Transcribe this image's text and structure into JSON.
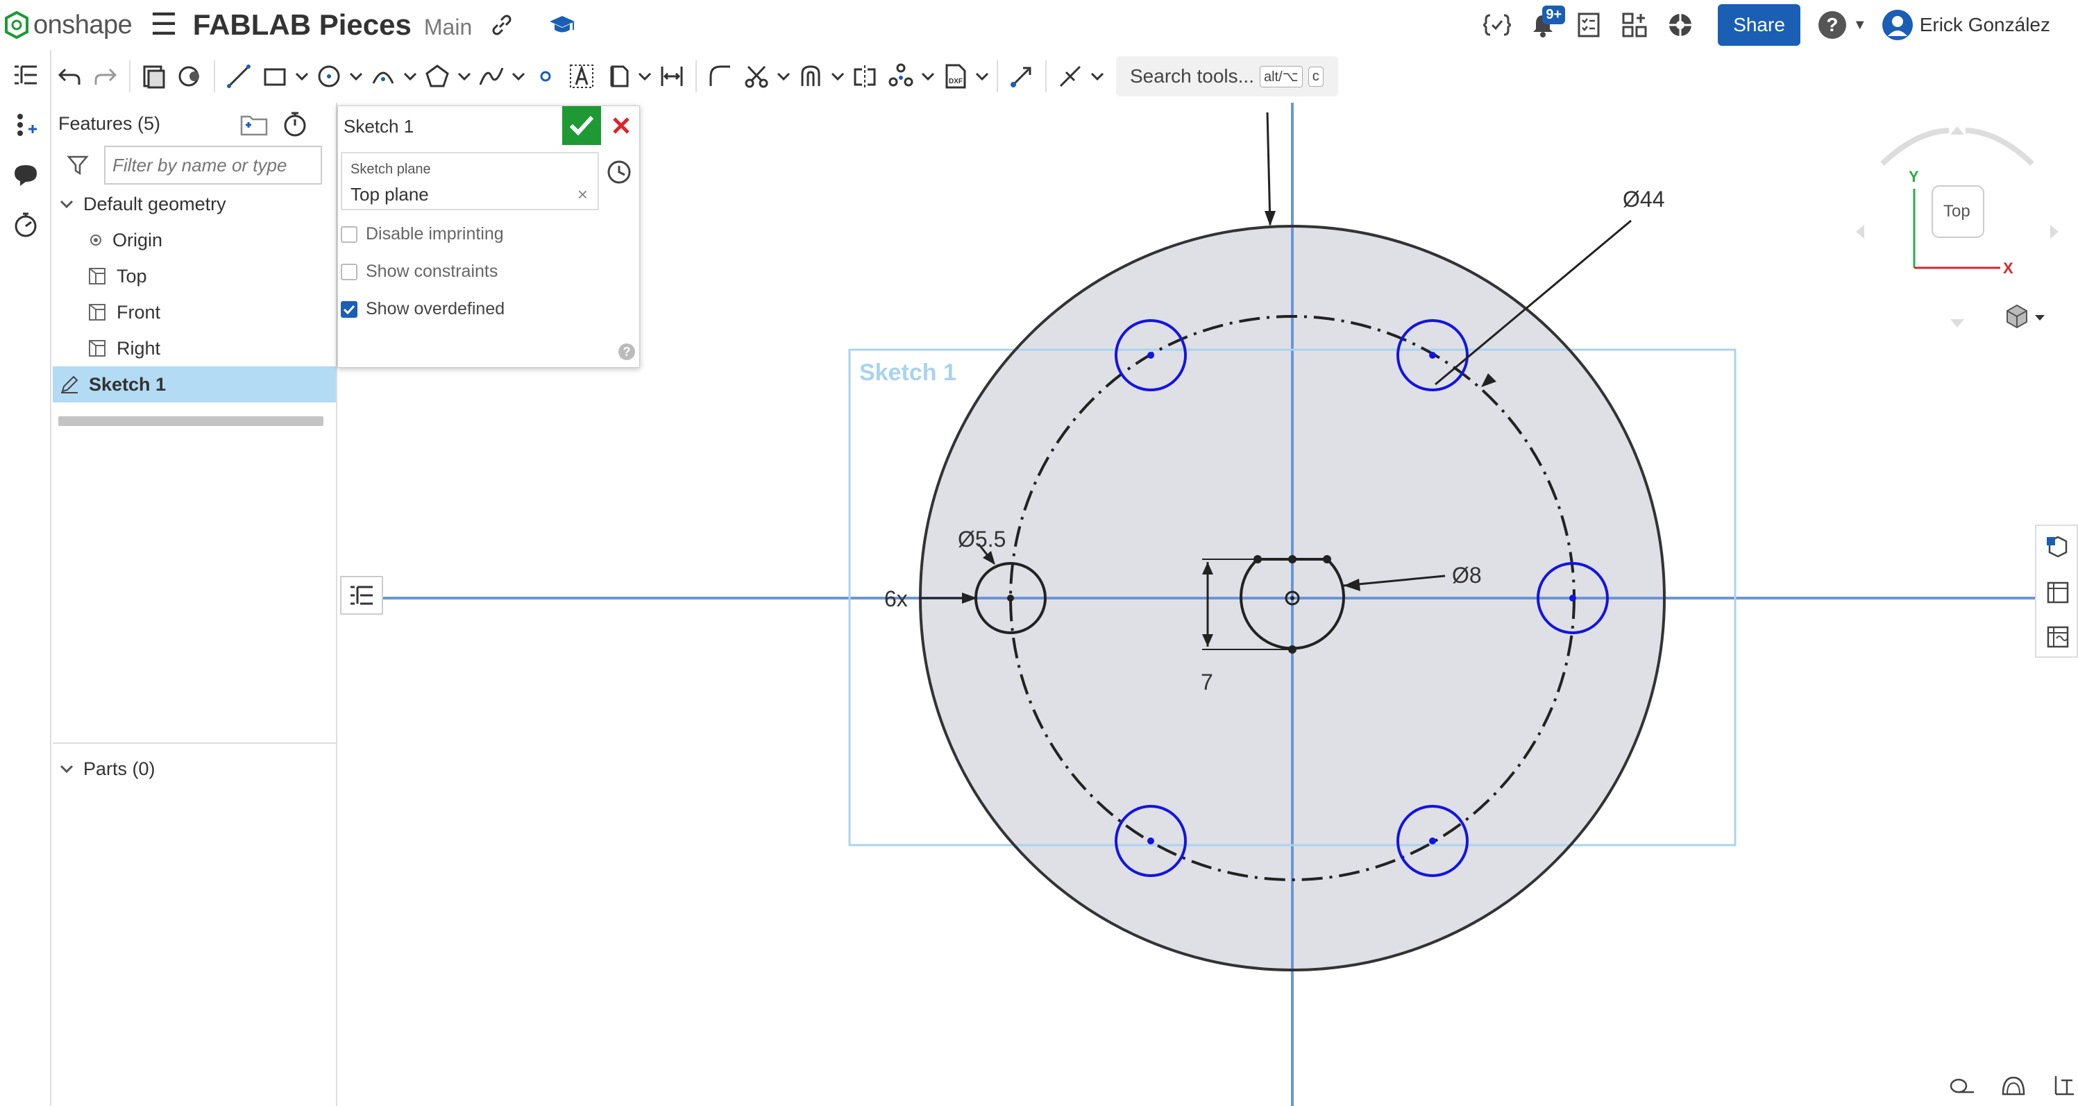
{
  "app": {
    "logo_text": "onshape",
    "document_title": "FABLAB Pieces",
    "branch": "Main",
    "notifications_badge": "9+",
    "share_label": "Share",
    "help_label": "?",
    "user_name": "Erick González"
  },
  "toolbar": {
    "search_label": "Search tools...",
    "search_shortcut_1": "alt/⌥",
    "search_shortcut_2": "c"
  },
  "features": {
    "header": "Features (5)",
    "filter_placeholder": "Filter by name or type",
    "default_geometry": "Default geometry",
    "items": [
      "Origin",
      "Top",
      "Front",
      "Right"
    ],
    "selected": "Sketch 1",
    "parts_header": "Parts (0)"
  },
  "sketch_dialog": {
    "title": "Sketch 1",
    "plane_label": "Sketch plane",
    "plane_value": "Top plane",
    "plane_clear": "×",
    "disable_imprinting": "Disable imprinting",
    "show_constraints": "Show constraints",
    "show_overdefined": "Show overdefined",
    "disable_imprinting_checked": false,
    "show_constraints_checked": false,
    "show_overdefined_checked": true
  },
  "viewport": {
    "sketch_label": "Sketch 1",
    "dim_outer": "Ø44",
    "dim_hole": "Ø5.5",
    "dim_count": "6x",
    "dim_center": "Ø8",
    "dim_flat": "7",
    "view_cube_face": "Top",
    "axis_x": "X",
    "axis_y": "Y"
  },
  "colors": {
    "accent": "#1a5fb4",
    "sketch_blue": "#1414e0",
    "ok_green": "#1e9934",
    "cancel_red": "#d9262c",
    "selected_row": "#b3dbf3",
    "sketch_fill": "#dfe0e6"
  }
}
